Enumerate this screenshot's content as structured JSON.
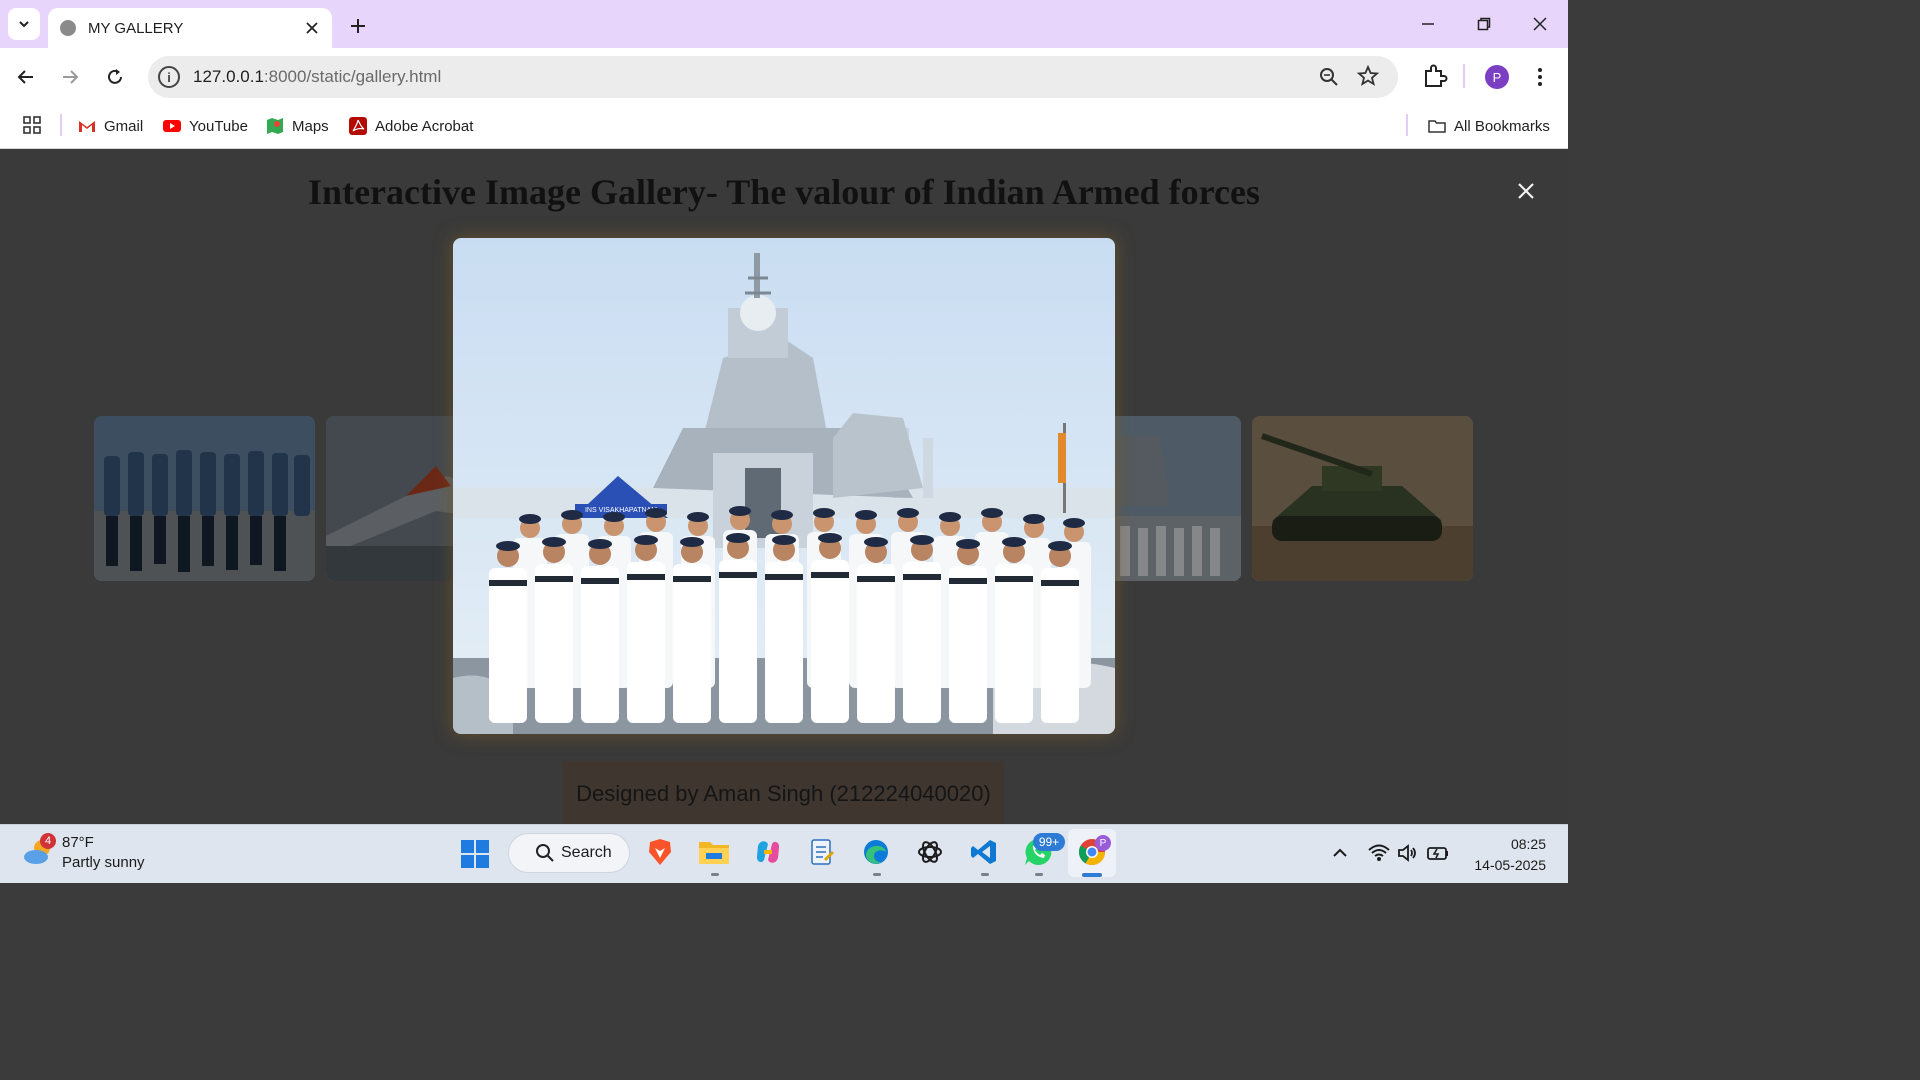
{
  "browser": {
    "tab_title": "MY GALLERY",
    "url_host": "127.0.0.1",
    "url_rest": ":8000/static/gallery.html",
    "avatar_letter": "P",
    "bookmarks": [
      {
        "label": "Gmail",
        "icon": "gmail-icon",
        "color": "#d93025"
      },
      {
        "label": "YouTube",
        "icon": "youtube-icon",
        "color": "#ff0000"
      },
      {
        "label": "Maps",
        "icon": "maps-icon",
        "color": "#34a853"
      },
      {
        "label": "Adobe Acrobat",
        "icon": "acrobat-icon",
        "color": "#b30b00"
      }
    ],
    "all_bookmarks": "All Bookmarks"
  },
  "page": {
    "heading": "Interactive Image Gallery- The valour of Indian Armed forces",
    "footer": "Designed by Aman Singh (212224040020)",
    "close_symbol": "×",
    "lightbox_sign": "INS VISAKHAPATNAM"
  },
  "taskbar": {
    "weather_badge": "4",
    "temperature": "87°F",
    "weather": "Partly sunny",
    "search_label": "Search",
    "whatsapp_badge": "99+",
    "chrome_profile": "P",
    "time": "08:25",
    "date": "14-05-2025"
  }
}
